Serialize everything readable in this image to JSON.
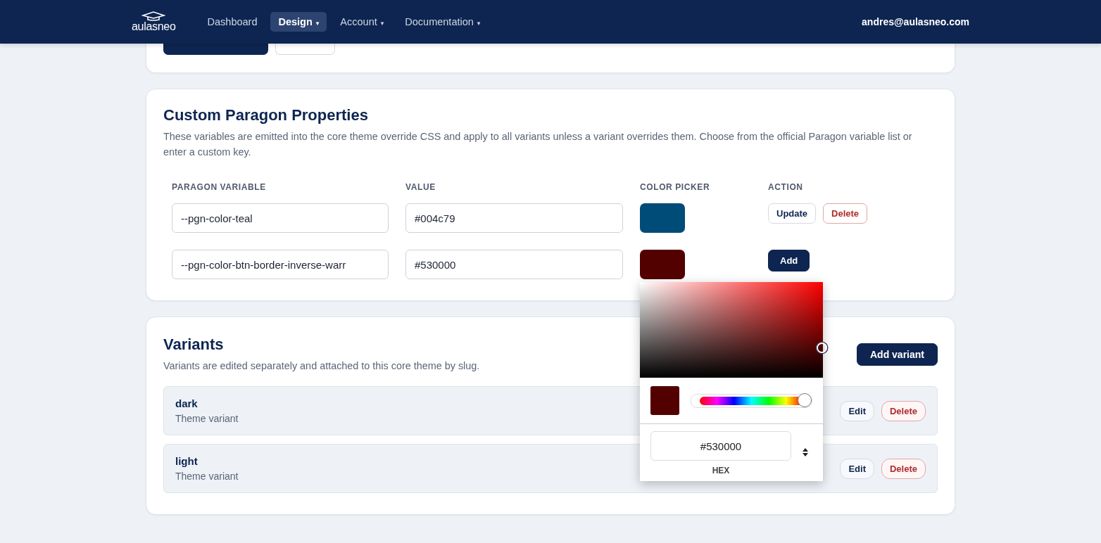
{
  "header": {
    "logo": "aulasneo",
    "nav": [
      {
        "label": "Dashboard",
        "selected": false
      },
      {
        "label": "Design",
        "caret": "▾",
        "selected": true
      },
      {
        "label": "Account",
        "caret": "▾",
        "selected": false
      },
      {
        "label": "Documentation",
        "caret": "▾",
        "selected": false
      }
    ],
    "user": "andres@aulasneo.com"
  },
  "properties": {
    "title": "Custom Paragon Properties",
    "description": "These variables are emitted into the core theme override CSS and apply to all variants unless a variant overrides them. Choose from the official Paragon variable list or enter a custom key.",
    "columns": [
      "PARAGON VARIABLE",
      "VALUE",
      "COLOR PICKER",
      "ACTION"
    ],
    "rows": [
      {
        "variable": "--pgn-color-teal",
        "value": "#004c79",
        "color": "#004c79",
        "actions": [
          {
            "label": "Update",
            "kind": "secondary"
          },
          {
            "label": "Delete",
            "kind": "danger"
          }
        ]
      },
      {
        "variable": "--pgn-color-btn-border-inverse-warr",
        "value": "#530000",
        "color": "#530000",
        "actions": [
          {
            "label": "Add",
            "kind": "primary"
          }
        ]
      }
    ]
  },
  "picker": {
    "open": true,
    "color": "#530000",
    "level": 0.94,
    "hex": "#530000",
    "format": "HEX"
  },
  "variants": {
    "title": "Variants",
    "description": "Variants are edited separately and attached to this core theme by slug.",
    "add_button": "Add variant",
    "items": [
      {
        "name": "dark",
        "subtitle": "Theme variant",
        "actions": [
          {
            "label": "Edit",
            "kind": "secondary"
          },
          {
            "label": "Delete",
            "kind": "danger"
          }
        ]
      },
      {
        "name": "light",
        "subtitle": "Theme variant",
        "actions": [
          {
            "label": "Edit",
            "kind": "secondary"
          },
          {
            "label": "Delete",
            "kind": "danger"
          }
        ]
      }
    ]
  }
}
